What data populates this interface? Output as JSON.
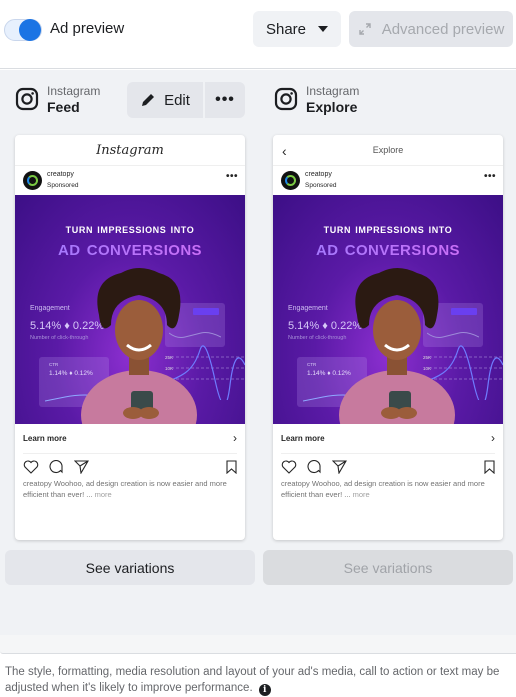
{
  "header": {
    "toggle_label": "Ad preview",
    "toggle_on": true,
    "share_label": "Share",
    "advanced_preview_label": "Advanced preview"
  },
  "colors": {
    "accent": "#1b74e4",
    "panel_bg": "#f0f2f5",
    "creative_purple": "#5a1aa6"
  },
  "placements": [
    {
      "platform": "Instagram",
      "name": "Feed",
      "edit_label": "Edit",
      "more_label": "•••",
      "card_header": "Instagram",
      "account": "creatopy",
      "sponsored": "Sponsored",
      "post_menu": "•••",
      "creative": {
        "headline_1": "Turn impressions into",
        "headline_2": "Ad conversions",
        "engagement_label": "Engagement",
        "engagement_value": "5.14% ♦ 0.22%",
        "engagement_sub": "Number of click-through",
        "ctr_label": "CTR",
        "ctr_value": "1.14% ♦ 0.12%",
        "chart_tick_1": "25K",
        "chart_tick_2": "10K"
      },
      "cta_label": "Learn more",
      "caption_account": "creatopy",
      "caption_text": " Woohoo, ad design creation is now easier and more efficient than ever! ... ",
      "caption_more": "more",
      "variations_label": "See variations",
      "variations_enabled": true
    },
    {
      "platform": "Instagram",
      "name": "Explore",
      "card_header": "Explore",
      "account": "creatopy",
      "sponsored": "Sponsored",
      "post_menu": "•••",
      "creative": {
        "headline_1": "Turn impressions into",
        "headline_2": "Ad conversions",
        "engagement_label": "Engagement",
        "engagement_value": "5.14% ♦ 0.22%",
        "engagement_sub": "Number of click-through",
        "ctr_label": "CTR",
        "ctr_value": "1.14% ♦ 0.12%",
        "chart_tick_1": "25K",
        "chart_tick_2": "10K"
      },
      "cta_label": "Learn more",
      "caption_account": "creatopy",
      "caption_text": " Woohoo, ad design creation is now easier and more efficient than ever! ... ",
      "caption_more": "more",
      "variations_label": "See variations",
      "variations_enabled": false
    }
  ],
  "footnote": "The style, formatting, media resolution and layout of your ad's media, call to action or text may be adjusted when it's likely to improve performance.",
  "info_icon": "i"
}
